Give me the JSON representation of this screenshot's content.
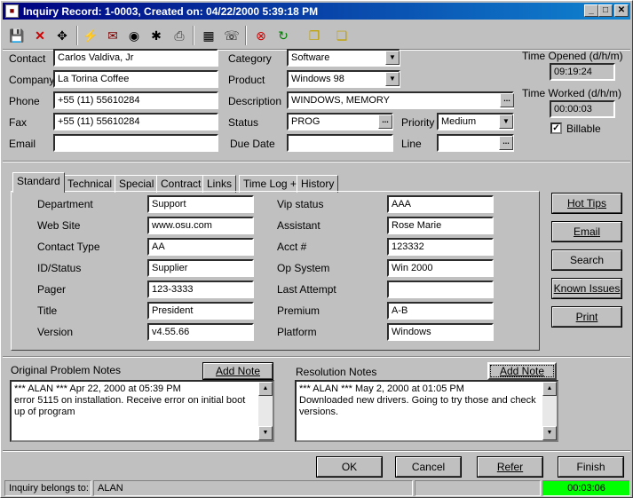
{
  "window": {
    "title": "Inquiry Record: 1-0003, Created on: 04/22/2000 5:39:18 PM"
  },
  "toolbar": {
    "icons": [
      "save-icon",
      "delete-icon",
      "navigate-icon",
      "lightning-icon",
      "email-icon",
      "binoculars-icon",
      "bug-icon",
      "print-icon",
      "calculator-icon",
      "phone-icon",
      "alarm-icon",
      "refresh-icon",
      "copy-icon",
      "paste-icon"
    ]
  },
  "header": {
    "contact_label": "Contact",
    "contact_value": "Carlos Valdiva, Jr",
    "company_label": "Company",
    "company_value": "La Torina Coffee",
    "phone_label": "Phone",
    "phone_value": "+55 (11) 55610284",
    "fax_label": "Fax",
    "fax_value": "+55 (11) 55610284",
    "email_label": "Email",
    "email_value": "",
    "category_label": "Category",
    "category_value": "Software",
    "product_label": "Product",
    "product_value": "Windows 98",
    "description_label": "Description",
    "description_value": "WINDOWS, MEMORY",
    "status_label": "Status",
    "status_value": "PROG",
    "priority_label": "Priority",
    "priority_value": "Medium",
    "duedate_label": "Due Date",
    "duedate_value": "",
    "line_label": "Line",
    "line_value": "",
    "time_opened_label": "Time Opened (d/h/m)",
    "time_opened_value": "09:19:24",
    "time_worked_label": "Time Worked (d/h/m)",
    "time_worked_value": "00:00:03",
    "billable_label": "Billable",
    "billable_checked": true
  },
  "tabs": [
    "Standard",
    "Technical",
    "Special",
    "Contract",
    "Links",
    "Time Log +",
    "History"
  ],
  "standard": {
    "left": [
      {
        "label": "Department",
        "value": "Support"
      },
      {
        "label": "Web Site",
        "value": "www.osu.com"
      },
      {
        "label": "Contact Type",
        "value": "AA"
      },
      {
        "label": "ID/Status",
        "value": "Supplier"
      },
      {
        "label": "Pager",
        "value": "123-3333"
      },
      {
        "label": "Title",
        "value": "President"
      },
      {
        "label": "Version",
        "value": "v4.55.66"
      }
    ],
    "right": [
      {
        "label": "Vip status",
        "value": "AAA"
      },
      {
        "label": "Assistant",
        "value": "Rose Marie"
      },
      {
        "label": "Acct #",
        "value": "123332"
      },
      {
        "label": "Op System",
        "value": "Win 2000"
      },
      {
        "label": "Last Attempt",
        "value": ""
      },
      {
        "label": "Premium",
        "value": "A-B"
      },
      {
        "label": "Platform",
        "value": "Windows"
      }
    ]
  },
  "side_buttons": {
    "hot_tips": "Hot Tips",
    "email": "Email",
    "search": "Search",
    "known_issues": "Known Issues",
    "print": "Print"
  },
  "notes": {
    "original_label": "Original Problem Notes",
    "original_add": "Add Note",
    "original_text_1": "*** ALAN ***  Apr 22, 2000 at 05:39 PM",
    "original_text_2": "error 5115 on installation.  Receive error on initial boot up of program",
    "resolution_label": "Resolution Notes",
    "resolution_add": "Add Note",
    "resolution_text_1": "*** ALAN ***  May 2, 2000 at 01:05 PM",
    "resolution_text_2": "Downloaded new drivers.  Going to try those and check versions."
  },
  "footer": {
    "ok": "OK",
    "cancel": "Cancel",
    "refer": "Refer",
    "finish": "Finish"
  },
  "statusbar": {
    "belongs_label": "Inquiry belongs to:",
    "belongs_value": "ALAN",
    "timer": "00:03:06",
    "timer_color": "#00ff00"
  }
}
